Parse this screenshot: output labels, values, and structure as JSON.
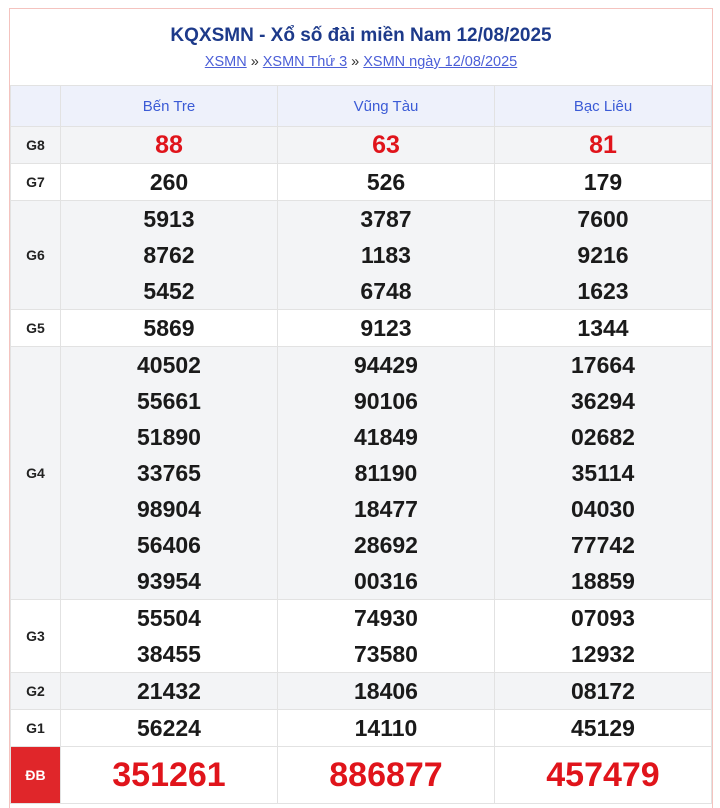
{
  "header": {
    "title": "KQXSMN - Xổ số đài miền Nam 12/08/2025",
    "breadcrumb": [
      {
        "label": "XSMN"
      },
      {
        "label": "XSMN Thứ 3"
      },
      {
        "label": "XSMN ngày 12/08/2025"
      }
    ],
    "separator": "»"
  },
  "provinces": [
    "Bến Tre",
    "Vũng Tàu",
    "Bạc Liêu"
  ],
  "prizes": [
    {
      "label": "G8",
      "values": [
        [
          "88"
        ],
        [
          "63"
        ],
        [
          "81"
        ]
      ]
    },
    {
      "label": "G7",
      "values": [
        [
          "260"
        ],
        [
          "526"
        ],
        [
          "179"
        ]
      ]
    },
    {
      "label": "G6",
      "values": [
        [
          "5913",
          "8762",
          "5452"
        ],
        [
          "3787",
          "1183",
          "6748"
        ],
        [
          "7600",
          "9216",
          "1623"
        ]
      ]
    },
    {
      "label": "G5",
      "values": [
        [
          "5869"
        ],
        [
          "9123"
        ],
        [
          "1344"
        ]
      ]
    },
    {
      "label": "G4",
      "values": [
        [
          "40502",
          "55661",
          "51890",
          "33765",
          "98904",
          "56406",
          "93954"
        ],
        [
          "94429",
          "90106",
          "41849",
          "81190",
          "18477",
          "28692",
          "00316"
        ],
        [
          "17664",
          "36294",
          "02682",
          "35114",
          "04030",
          "77742",
          "18859"
        ]
      ]
    },
    {
      "label": "G3",
      "values": [
        [
          "55504",
          "38455"
        ],
        [
          "74930",
          "73580"
        ],
        [
          "07093",
          "12932"
        ]
      ]
    },
    {
      "label": "G2",
      "values": [
        [
          "21432"
        ],
        [
          "18406"
        ],
        [
          "08172"
        ]
      ]
    },
    {
      "label": "G1",
      "values": [
        [
          "56224"
        ],
        [
          "14110"
        ],
        [
          "45129"
        ]
      ]
    },
    {
      "label": "ĐB",
      "values": [
        [
          "351261"
        ],
        [
          "886877"
        ],
        [
          "457479"
        ]
      ]
    }
  ],
  "colors": {
    "title": "#1d3a8a",
    "link": "#4c5fd7",
    "header_bg": "#eef1fb",
    "special_red": "#e0141b",
    "db_label_bg": "#e0262a"
  }
}
